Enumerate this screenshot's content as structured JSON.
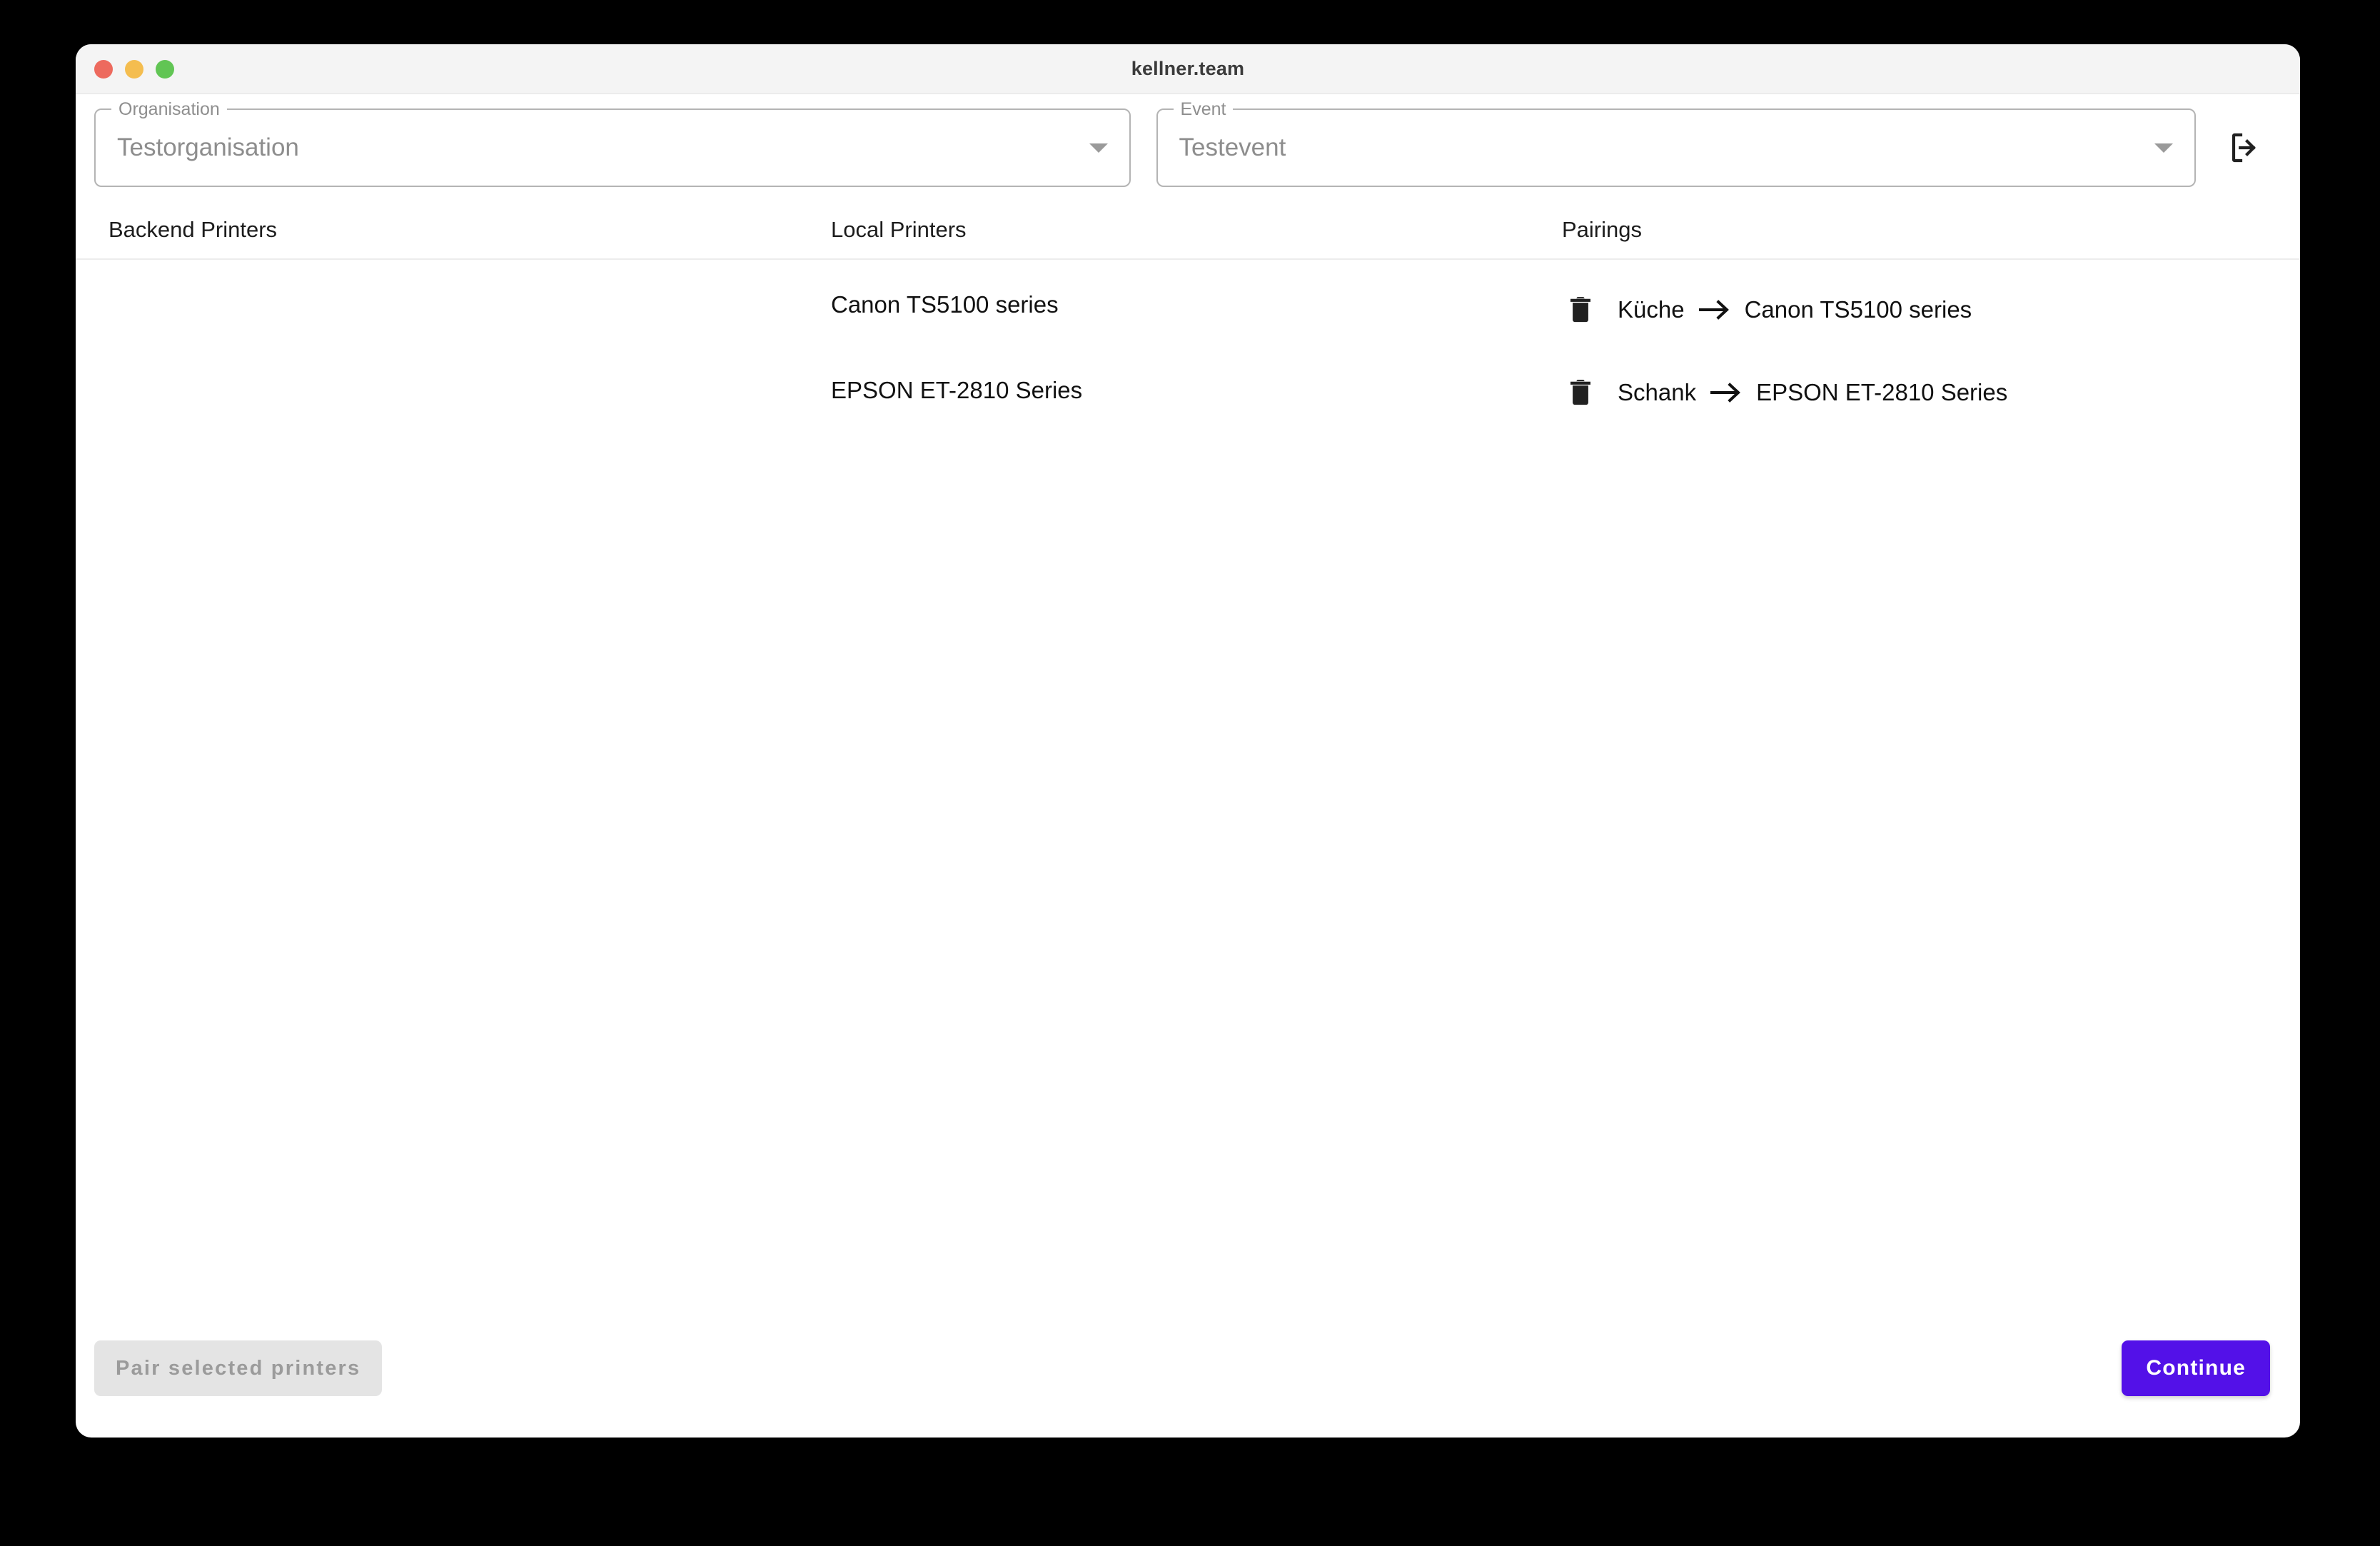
{
  "window": {
    "title": "kellner.team",
    "traffic_lights": [
      {
        "name": "close",
        "color": "#ed6a5e"
      },
      {
        "name": "minimize",
        "color": "#f4bd4f"
      },
      {
        "name": "maximize",
        "color": "#61c554"
      }
    ]
  },
  "selectors": {
    "organisation": {
      "label": "Organisation",
      "value": "Testorganisation",
      "arrow_icon": "chevron-down-icon"
    },
    "event": {
      "label": "Event",
      "value": "Testevent",
      "arrow_icon": "chevron-down-icon"
    },
    "logout": {
      "icon": "logout-icon",
      "tooltip": "Logout"
    }
  },
  "columns": {
    "backend_printers": {
      "header": "Backend Printers",
      "items": []
    },
    "local_printers": {
      "header": "Local Printers",
      "items": [
        "Canon TS5100 series",
        "EPSON ET-2810 Series"
      ]
    },
    "pairings": {
      "header": "Pairings",
      "delete_icon": "trash-icon",
      "arrow_icon": "arrow-right-icon",
      "items": [
        {
          "source": "Küche",
          "target": "Canon TS5100 series"
        },
        {
          "source": "Schank",
          "target": "EPSON ET-2810 Series"
        }
      ]
    }
  },
  "footer": {
    "pair_selected_label": "Pair selected printers",
    "pair_selected_disabled": true,
    "continue_label": "Continue",
    "continue_color": "#5311e8"
  }
}
